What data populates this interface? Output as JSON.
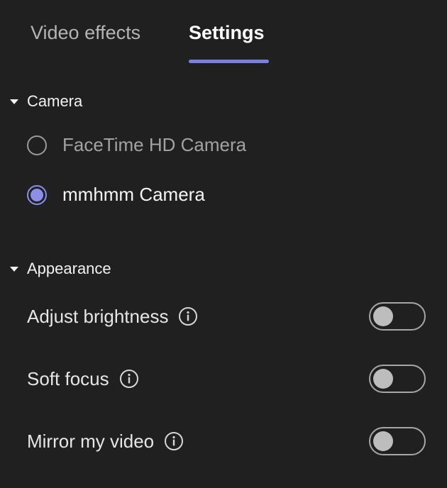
{
  "tabs": {
    "video_effects": "Video effects",
    "settings": "Settings",
    "active": "Settings"
  },
  "camera": {
    "title": "Camera",
    "options": [
      {
        "label": "FaceTime HD Camera",
        "selected": false
      },
      {
        "label": "mmhmm Camera",
        "selected": true
      }
    ]
  },
  "appearance": {
    "title": "Appearance",
    "settings": [
      {
        "label": "Adjust brightness",
        "enabled": false,
        "icon": "info-icon"
      },
      {
        "label": "Soft focus",
        "enabled": false,
        "icon": "info-icon"
      },
      {
        "label": "Mirror my video",
        "enabled": false,
        "icon": "info-icon"
      }
    ]
  },
  "colors": {
    "background": "#202020",
    "accent": "#7b80e0"
  }
}
